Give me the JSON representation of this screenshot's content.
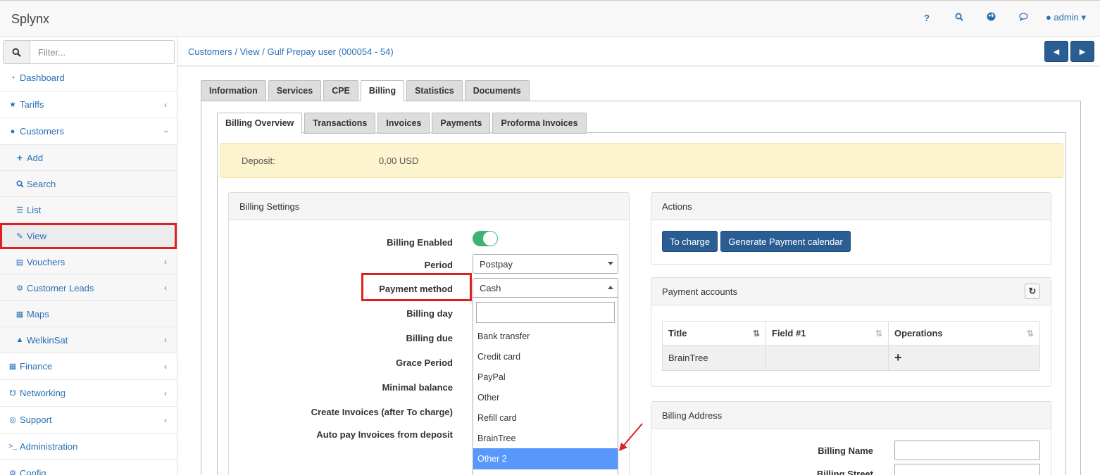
{
  "app": {
    "brand": "Splynx",
    "user": "admin"
  },
  "top_icons": [
    "help-icon",
    "search-icon",
    "globe-icon",
    "chat-icon"
  ],
  "sidebar": {
    "filter_placeholder": "Filter...",
    "items": [
      {
        "label": "Dashboard",
        "icon": "dashboard-icon"
      },
      {
        "label": "Tariffs",
        "icon": "star-icon"
      },
      {
        "label": "Customers",
        "icon": "user-icon"
      },
      {
        "label": "Add",
        "icon": "plus-icon"
      },
      {
        "label": "Search",
        "icon": "search-icon"
      },
      {
        "label": "List",
        "icon": "list-icon"
      },
      {
        "label": "View",
        "icon": "pencil-icon"
      },
      {
        "label": "Vouchers",
        "icon": "voucher-icon"
      },
      {
        "label": "Customer Leads",
        "icon": "gear-icon"
      },
      {
        "label": "Maps",
        "icon": "map-icon"
      },
      {
        "label": "WelkinSat",
        "icon": "satellite-icon"
      },
      {
        "label": "Finance",
        "icon": "calculator-icon"
      },
      {
        "label": "Networking",
        "icon": "network-icon"
      },
      {
        "label": "Support",
        "icon": "lifebuoy-icon"
      },
      {
        "label": "Administration",
        "icon": "terminal-icon"
      },
      {
        "label": "Config",
        "icon": "gears-icon"
      }
    ]
  },
  "breadcrumb": "Customers / View / Gulf Prepay user (000054 - 54)",
  "nav_buttons": {
    "prev": "◀",
    "next": "▶"
  },
  "tabs": [
    "Information",
    "Services",
    "CPE",
    "Billing",
    "Statistics",
    "Documents"
  ],
  "active_tab": "Billing",
  "subtabs": [
    "Billing Overview",
    "Transactions",
    "Invoices",
    "Payments",
    "Proforma Invoices"
  ],
  "active_subtab": "Billing Overview",
  "deposit": {
    "label": "Deposit:",
    "value": "0,00 USD"
  },
  "billing_settings": {
    "title": "Billing Settings",
    "labels": {
      "enabled": "Billing Enabled",
      "period": "Period",
      "payment_method": "Payment method",
      "billing_day": "Billing day",
      "billing_due": "Billing due",
      "grace_period": "Grace Period",
      "minimal_balance": "Minimal balance",
      "create_invoices": "Create Invoices (after To charge)",
      "auto_pay": "Auto pay Invoices from deposit"
    },
    "billing_enabled": true,
    "period_value": "Postpay",
    "payment_method_value": "Cash",
    "payment_options": [
      "Bank transfer",
      "Credit card",
      "PayPal",
      "Other",
      "Refill card",
      "BrainTree",
      "Other 2"
    ],
    "highlighted_option": "Other 2"
  },
  "actions": {
    "title": "Actions",
    "to_charge": "To charge",
    "generate_calendar": "Generate Payment calendar"
  },
  "payment_accounts": {
    "title": "Payment accounts",
    "columns": [
      "Title",
      "Field #1",
      "Operations"
    ],
    "rows": [
      {
        "title": "BrainTree",
        "field1": "",
        "operations": "+"
      }
    ]
  },
  "billing_address": {
    "title": "Billing Address",
    "labels": {
      "name": "Billing Name",
      "street": "Billing Street"
    }
  },
  "colors": {
    "link": "#2a6fb5",
    "primary_button": "#2a5d93",
    "toggle_on": "#3cb371",
    "highlight": "#5897fb",
    "annotation": "#e02020",
    "deposit_bg": "#fcf3cf"
  }
}
